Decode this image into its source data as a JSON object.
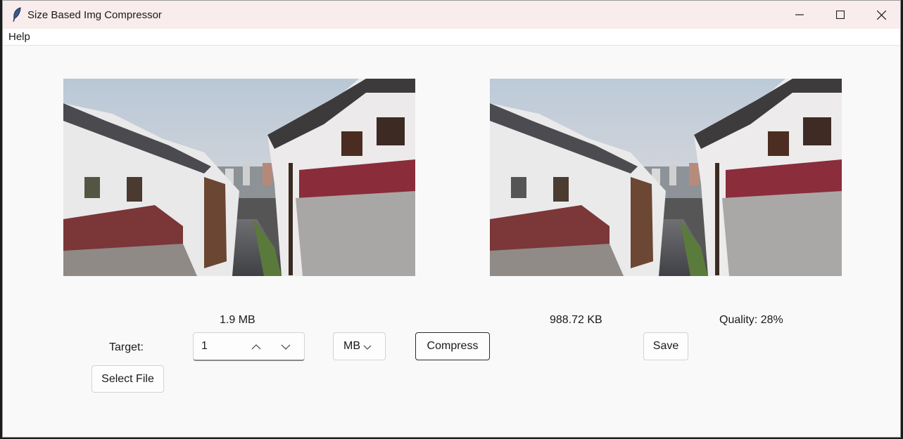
{
  "window": {
    "title": "Size Based Img Compressor"
  },
  "menu": {
    "help": "Help"
  },
  "original": {
    "size": "1.9 MB"
  },
  "compressed": {
    "size": "988.72 KB",
    "quality": "Quality: 28%"
  },
  "target": {
    "label": "Target:",
    "value": "1",
    "unit": "MB"
  },
  "buttons": {
    "compress": "Compress",
    "save": "Save",
    "select_file": "Select File"
  }
}
